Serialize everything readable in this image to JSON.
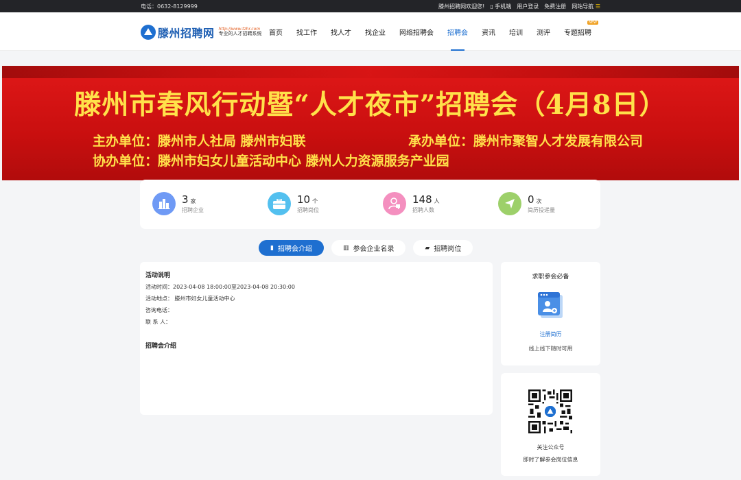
{
  "topbar": {
    "phone": "电话：0632-8129999",
    "welcome": "滕州招聘网欢迎您!",
    "mobile": "手机端",
    "login": "用户登录",
    "register": "免费注册",
    "sitemap": "网站导航"
  },
  "header": {
    "logo_text": "滕州招聘网",
    "logo_url": "http://www.tzhr.com",
    "logo_slogan": "专业的人才招聘系统",
    "nav": [
      "首页",
      "找工作",
      "找人才",
      "找企业",
      "网络招聘会",
      "招聘会",
      "资讯",
      "培训",
      "测评",
      "专题招聘"
    ],
    "nav_new_badge": "NEW"
  },
  "banner": {
    "title": "滕州市春风行动暨“人才夜市”招聘会（4月8日）",
    "host": "主办单位：滕州市人社局    滕州市妇联",
    "organizer": "承办单位：滕州市聚智人才发展有限公司",
    "co_organizer": "协办单位：滕州市妇女儿童活动中心    滕州人力资源服务产业园"
  },
  "stats": [
    {
      "value": "3",
      "unit": "家",
      "label": "招聘企业",
      "color": "#6f9af5"
    },
    {
      "value": "10",
      "unit": "个",
      "label": "招聘岗位",
      "color": "#53c0ef"
    },
    {
      "value": "148",
      "unit": "人",
      "label": "招聘人数",
      "color": "#f48fbf"
    },
    {
      "value": "0",
      "unit": "次",
      "label": "简历投递量",
      "color": "#9dd06a"
    }
  ],
  "tabs": [
    "招聘会介绍",
    "参会企业名录",
    "招聘岗位"
  ],
  "main": {
    "section1_title": "活动说明",
    "time": "活动时间：2023-04-08 18:00:00至2023-04-08 20:30:00",
    "place": "活动地点：  滕州市妇女儿童活动中心",
    "phone": "咨询电话：",
    "contact": "联 系 人：",
    "section2_title": "招聘会介绍"
  },
  "side": {
    "card1_title": "求职参会必备",
    "card1_link": "注册简历",
    "card1_desc": "线上线下随时可用",
    "card2_title": "关注公众号",
    "card2_desc": "即时了解参会岗位信息"
  },
  "colors": {
    "accent": "#1e6fd0",
    "banner_red": "#d41313",
    "banner_text": "#ffe14a",
    "topbar": "#232428"
  }
}
